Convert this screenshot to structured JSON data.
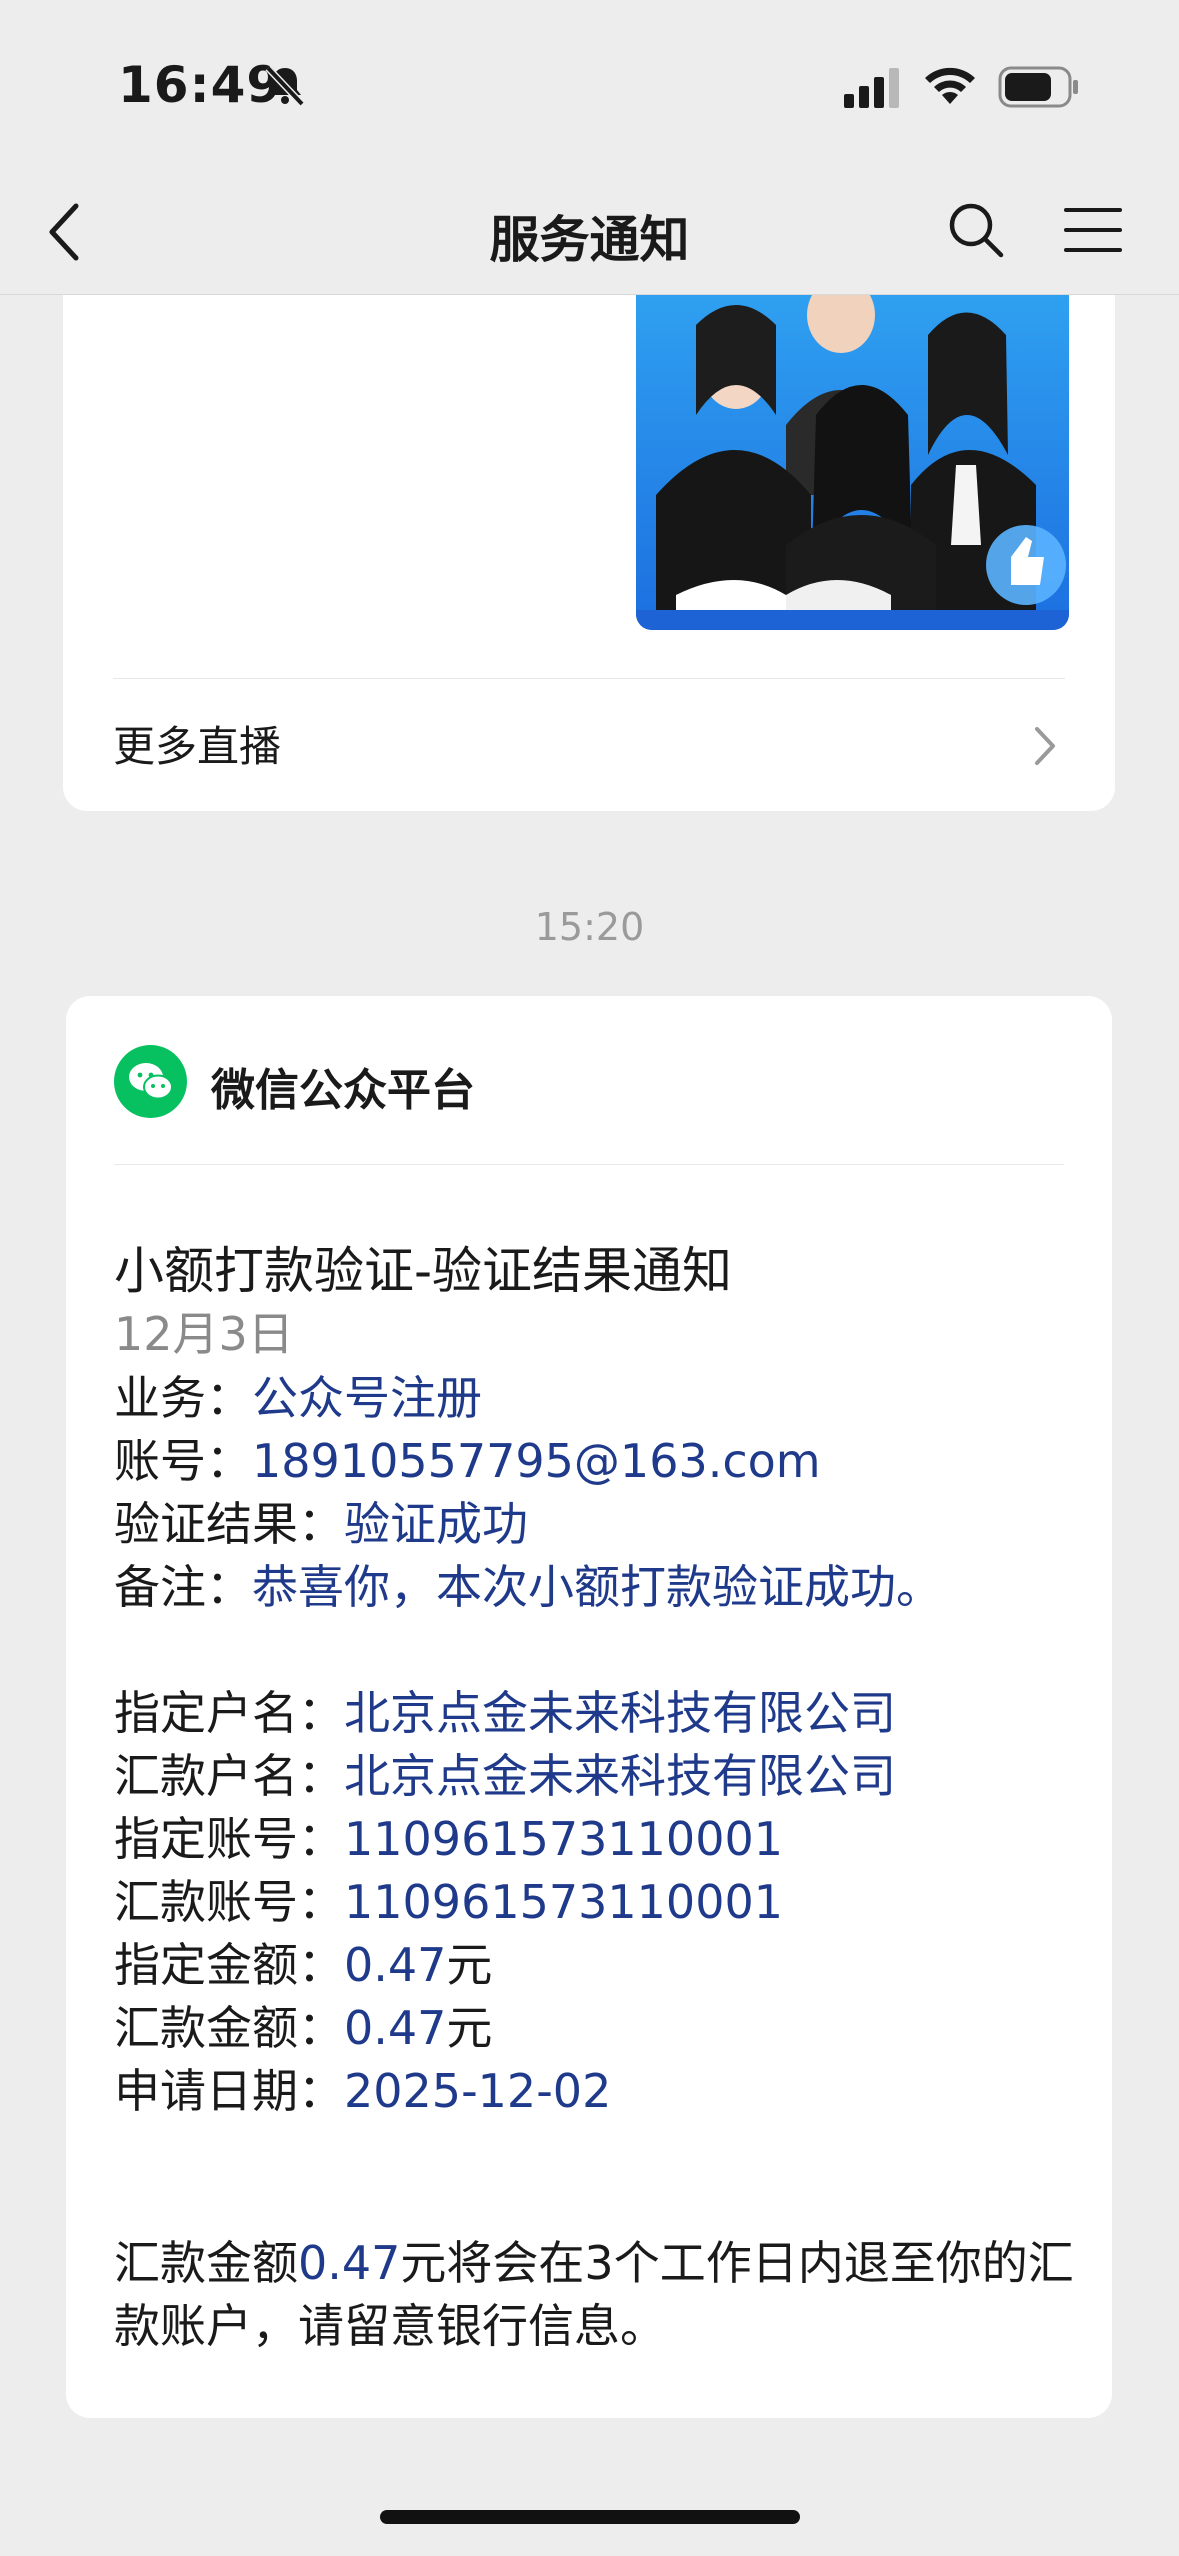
{
  "status_bar": {
    "time": "16:49"
  },
  "nav": {
    "title": "服务通知"
  },
  "top_card": {
    "more_live_label": "更多直播"
  },
  "timestamp": "15:20",
  "message": {
    "sender": "微信公众平台",
    "title": "小额打款验证-验证结果通知",
    "date": "12月3日",
    "group1": [
      {
        "key": "业务：",
        "value": "公众号注册"
      },
      {
        "key": "账号：",
        "value": "18910557795@163.com"
      },
      {
        "key": "验证结果：",
        "value": "验证成功"
      },
      {
        "key": "备注：",
        "value": "恭喜你，本次小额打款验证成功。"
      }
    ],
    "group2": [
      {
        "key": "指定户名：",
        "value": "北京点金未来科技有限公司"
      },
      {
        "key": "汇款户名：",
        "value": "北京点金未来科技有限公司"
      },
      {
        "key": "指定账号：",
        "value": "110961573110001"
      },
      {
        "key": "汇款账号：",
        "value": "110961573110001"
      },
      {
        "key": "指定金额：",
        "value": "0.47",
        "suffix": "元"
      },
      {
        "key": "汇款金额：",
        "value": "0.47",
        "suffix": "元"
      },
      {
        "key": "申请日期：",
        "value": "2025-12-02"
      }
    ],
    "footer": {
      "prefix": "汇款金额",
      "amount": "0.47",
      "rest": "元将会在3个工作日内退至你的汇款账户，请留意银行信息。"
    }
  },
  "colors": {
    "wechat_green": "#07c160",
    "value_blue": "#1f3a8a"
  }
}
